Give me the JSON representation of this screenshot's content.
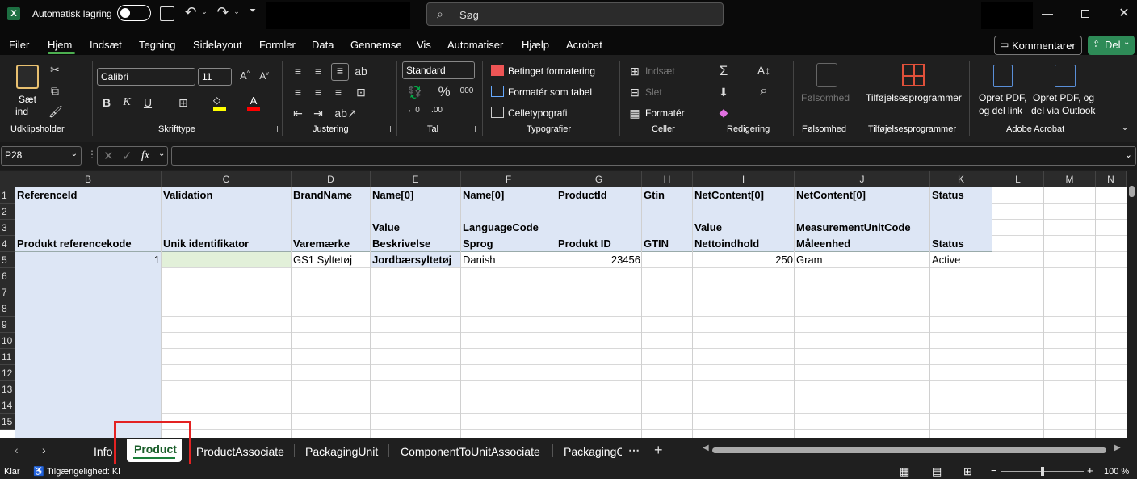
{
  "titlebar": {
    "autosave_label": "Automatisk lagring",
    "search_placeholder": "Søg"
  },
  "menu": {
    "tabs": [
      "Filer",
      "Hjem",
      "Indsæt",
      "Tegning",
      "Sidelayout",
      "Formler",
      "Data",
      "Gennemse",
      "Vis",
      "Automatiser",
      "Hjælp",
      "Acrobat"
    ],
    "active": "Hjem",
    "comment_label": "Kommentarer",
    "share_label": "Del"
  },
  "ribbon": {
    "paste_label_1": "Sæt",
    "paste_label_2": "ind",
    "font_name": "Calibri",
    "font_size": "11",
    "number_format": "Standard",
    "cond_format": "Betinget formatering",
    "format_table": "Formatér som tabel",
    "cell_styles": "Celletypografi",
    "insert": "Indsæt",
    "delete": "Slet",
    "format": "Formatér",
    "sensitivity": "Følsomhed",
    "addins": "Tilføjelsesprogrammer",
    "pdf_link_1": "Opret PDF,",
    "pdf_link_2": "og del link",
    "pdf_outlook_1": "Opret PDF, og",
    "pdf_outlook_2": "del via Outlook",
    "groups": {
      "clipboard": "Udklipsholder",
      "font": "Skrifttype",
      "alignment": "Justering",
      "number": "Tal",
      "styles": "Typografier",
      "cells": "Celler",
      "editing": "Redigering",
      "sensitivity": "Følsomhed",
      "addins": "Tilføjelsesprogrammer",
      "acrobat": "Adobe Acrobat"
    }
  },
  "formula": {
    "namebox": "P28",
    "fx": "fx"
  },
  "grid": {
    "columns": [
      "B",
      "C",
      "D",
      "E",
      "F",
      "G",
      "H",
      "I",
      "J",
      "K",
      "L",
      "M",
      "N"
    ],
    "rows": [
      "1",
      "2",
      "3",
      "4",
      "5",
      "6",
      "7",
      "8",
      "9",
      "10",
      "11",
      "12",
      "13",
      "14",
      "15"
    ],
    "r1": [
      "ReferenceId",
      "Validation",
      "BrandName",
      "Name[0]",
      "Name[0]",
      "ProductId",
      "Gtin",
      "NetContent[0]",
      "NetContent[0]",
      "Status"
    ],
    "r3": [
      "Value",
      "LanguageCode",
      "Value",
      "MeasurementUnitCode"
    ],
    "r4": [
      "Produkt referencekode",
      "Unik identifikator",
      "Varemærke",
      "Beskrivelse",
      "Sprog",
      "Produkt ID",
      "GTIN",
      "Nettoindhold",
      "Måleenhed",
      "Status"
    ],
    "r5": [
      "1",
      "",
      "GS1 Syltetøj",
      "Jordbærsyltetøj",
      "Danish",
      "23456",
      "",
      "250",
      "Gram",
      "Active"
    ]
  },
  "sheets": {
    "tabs": [
      "Info",
      "Product",
      "ProductAssociate",
      "PackagingUnit",
      "ComponentToUnitAssociate",
      "PackagingC"
    ],
    "active": "Product"
  },
  "status": {
    "ready": "Klar",
    "accessibility": "Tilgængelighed: Klar til start",
    "zoom": "100 %"
  }
}
